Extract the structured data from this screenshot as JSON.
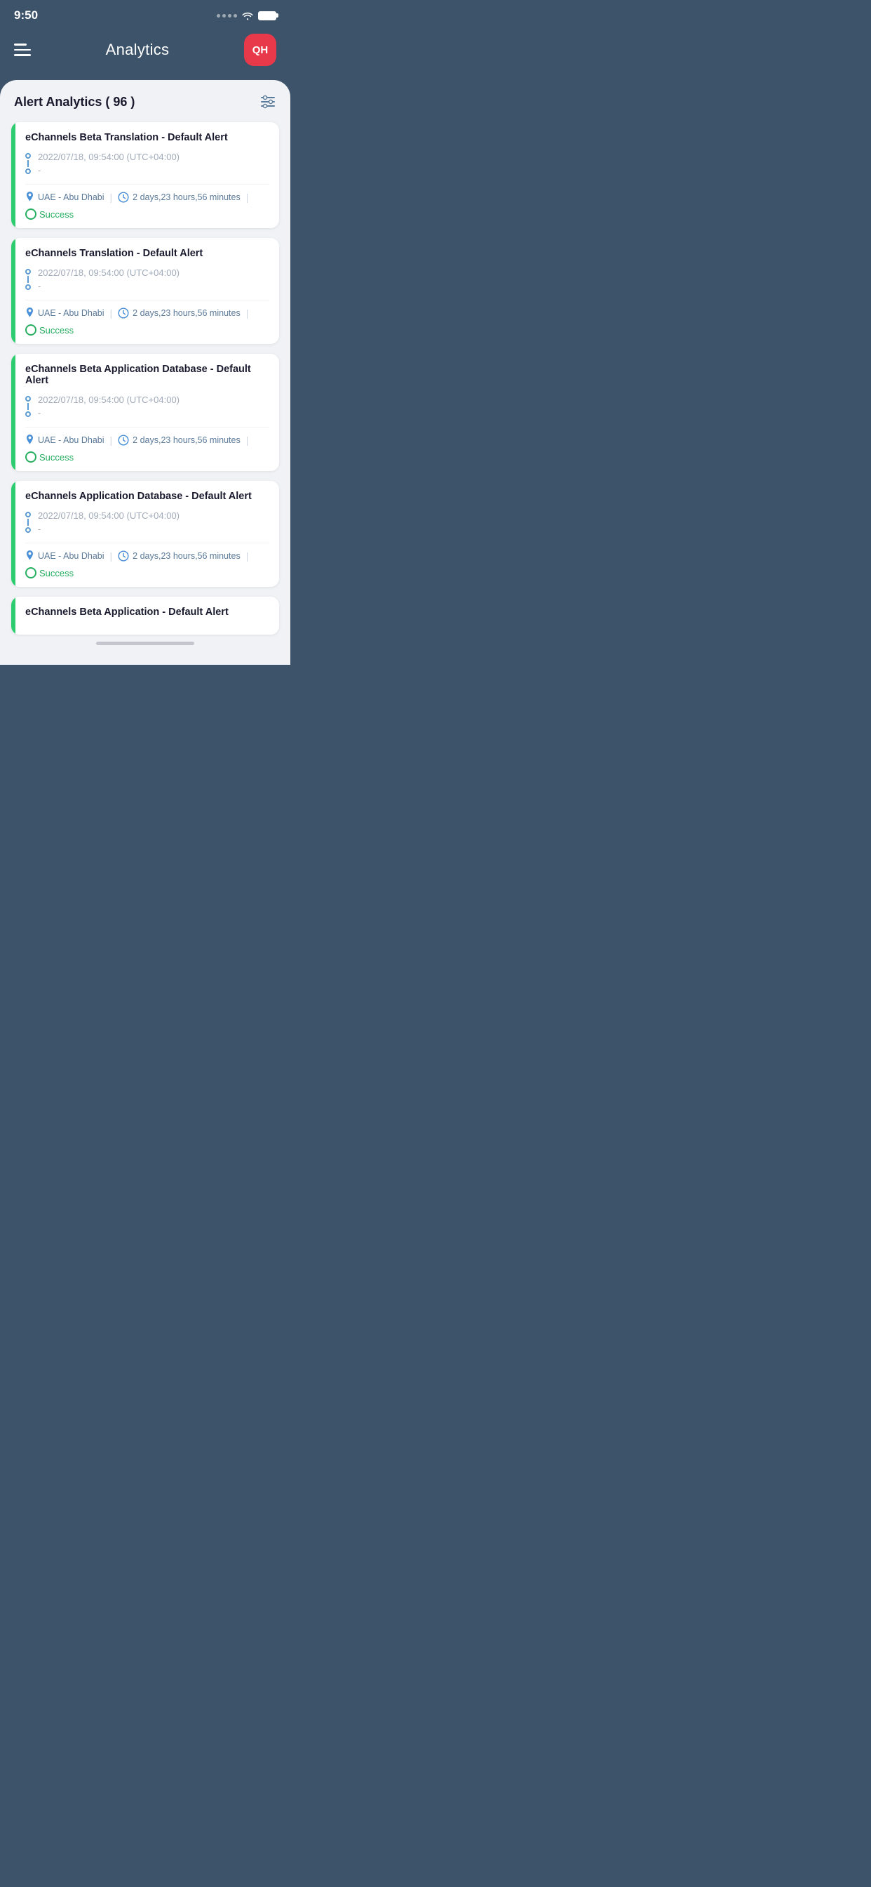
{
  "statusBar": {
    "time": "9:50"
  },
  "header": {
    "title": "Analytics",
    "avatar": "QH"
  },
  "alertSection": {
    "title": "Alert Analytics ( 96 )",
    "filterLabel": "filter"
  },
  "alerts": [
    {
      "id": 1,
      "title": "eChannels Beta Translation - Default Alert",
      "startDate": "2022/07/18, 09:54:00 (UTC+04:00)",
      "endDate": "-",
      "location": "UAE - Abu Dhabi",
      "duration": "2 days,23 hours,56 minutes",
      "status": "Success"
    },
    {
      "id": 2,
      "title": "eChannels Translation - Default Alert",
      "startDate": "2022/07/18, 09:54:00 (UTC+04:00)",
      "endDate": "-",
      "location": "UAE - Abu Dhabi",
      "duration": "2 days,23 hours,56 minutes",
      "status": "Success"
    },
    {
      "id": 3,
      "title": "eChannels Beta Application Database - Default Alert",
      "startDate": "2022/07/18, 09:54:00 (UTC+04:00)",
      "endDate": "-",
      "location": "UAE - Abu Dhabi",
      "duration": "2 days,23 hours,56 minutes",
      "status": "Success"
    },
    {
      "id": 4,
      "title": "eChannels Application Database - Default Alert",
      "startDate": "2022/07/18, 09:54:00 (UTC+04:00)",
      "endDate": "-",
      "location": "UAE - Abu Dhabi",
      "duration": "2 days,23 hours,56 minutes",
      "status": "Success"
    },
    {
      "id": 5,
      "title": "eChannels Beta Application - Default Alert",
      "startDate": "",
      "endDate": "",
      "location": "",
      "duration": "",
      "status": "",
      "partial": true
    }
  ]
}
